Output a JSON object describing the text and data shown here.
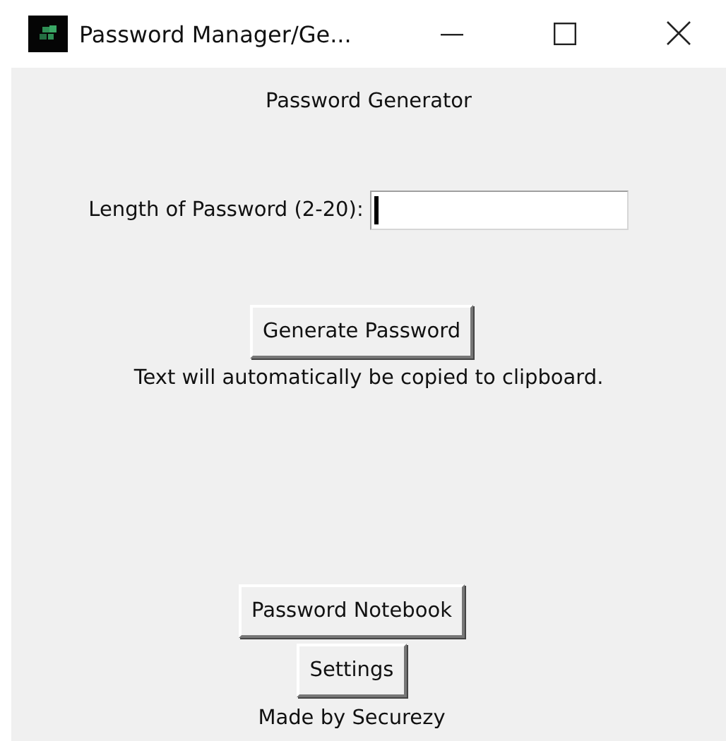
{
  "window": {
    "title": "Password Manager/Ge..."
  },
  "heading": "Password Generator",
  "length_field": {
    "label": "Length of Password (2-20):",
    "focused": true
  },
  "generate_button": "Generate Password",
  "note": "Text will automatically be copied to clipboard.",
  "buttons": [
    "Password Notebook",
    "Settings"
  ],
  "footer": "Made by Securezy"
}
